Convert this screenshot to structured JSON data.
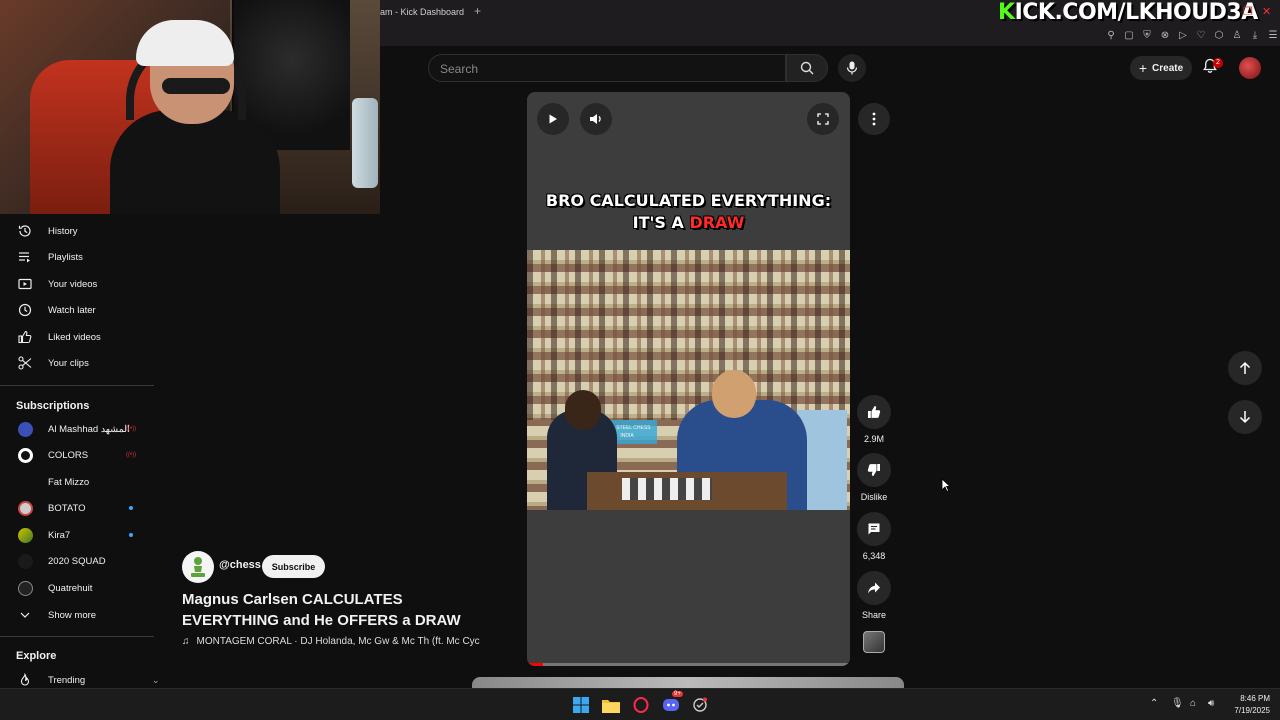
{
  "browser": {
    "tab_title": "am - Kick Dashboard",
    "tab_add": "+",
    "overlay_text_prefix": "K",
    "overlay_text_rest": "ICK.COM/LKHOUD3A"
  },
  "header": {
    "search_placeholder": "Search",
    "create_label": "Create",
    "notification_count": "2"
  },
  "sidebar": {
    "items": [
      {
        "label": "History",
        "icon": "history-icon"
      },
      {
        "label": "Playlists",
        "icon": "playlists-icon"
      },
      {
        "label": "Your videos",
        "icon": "your-videos-icon"
      },
      {
        "label": "Watch later",
        "icon": "watch-later-icon"
      },
      {
        "label": "Liked videos",
        "icon": "thumbs-up-icon"
      },
      {
        "label": "Your clips",
        "icon": "scissors-icon"
      }
    ],
    "subscriptions_title": "Subscriptions",
    "subscriptions": [
      {
        "label": "Al Mashhad المشهد",
        "status": "live"
      },
      {
        "label": "COLORS",
        "status": "live"
      },
      {
        "label": "Fat Mizzo",
        "status": ""
      },
      {
        "label": "BOTATO",
        "status": "new"
      },
      {
        "label": "Kira7",
        "status": "new"
      },
      {
        "label": "2020 SQUAD",
        "status": ""
      },
      {
        "label": "Quatrehuit",
        "status": ""
      }
    ],
    "show_more": "Show more",
    "explore_title": "Explore",
    "trending": "Trending",
    "live_badge": "((•))"
  },
  "video": {
    "caption_line1": "BRO CALCULATED EVERYTHING:",
    "caption_line2_prefix": "IT'S A",
    "caption_line2_highlight": "DRAW",
    "progress_fraction": 0.05,
    "channel": "@chess",
    "subscribe_label": "Subscribe",
    "title": "Magnus Carlsen CALCULATES EVERYTHING and He OFFERS a DRAW",
    "music": "MONTAGEM CORAL · DJ Holanda, Mc Gw & Mc Th (ft. Mc Cyc",
    "banner_text": "TATA STEEL CHESS INDIA"
  },
  "actions": {
    "likes": "2.9M",
    "dislike_label": "Dislike",
    "comments": "6,348",
    "share_label": "Share"
  },
  "taskbar": {
    "time": "8:46 PM",
    "date": "7/19/2025",
    "discord_badge": "9+"
  },
  "colors": {
    "accent_red": "#ff0000",
    "kick_green": "#53fc18",
    "background": "#0f0f0f"
  }
}
